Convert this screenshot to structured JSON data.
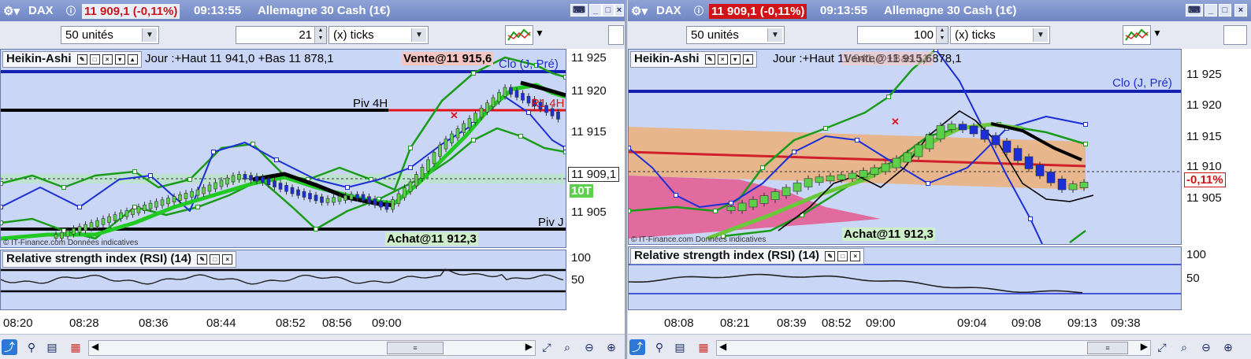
{
  "left": {
    "title": {
      "symbol": "DAX",
      "price": "11 909,1 (-0,11%)",
      "time": "09:13:55",
      "instrument": "Allemagne 30 Cash (1€)"
    },
    "toolbar": {
      "units": "50 unités",
      "ticks_value": "21",
      "ticks_label": "(x) ticks"
    },
    "chart": {
      "indicator_title": "Heikin-Ashi",
      "info": "Jour :+Haut 11 941,0 +Bas 11 878,1",
      "vente": "Vente@11 915,6",
      "achat": "Achat@11 912,3",
      "clo_label": "Clo (J, Pré)",
      "piv4h": "Piv 4H",
      "r1_4h": "R1 4H",
      "pivj": "Piv J",
      "copyright": "© IT-Finance.com  Données indicatives",
      "price_axis": [
        "11 925",
        "11 920",
        "11 915",
        "11 909,1",
        "11 905"
      ],
      "badge_10t": "10T"
    },
    "rsi": {
      "title": "Relative strength index (RSI) (14)",
      "axis": [
        "100",
        "50"
      ]
    },
    "time_axis": [
      "08:20",
      "08:28",
      "08:36",
      "08:44",
      "08:52",
      "08:56",
      "09:00"
    ]
  },
  "right": {
    "title": {
      "symbol": "DAX",
      "price": "11 909,1 (-0,11%)",
      "time": "09:13:55",
      "instrument": "Allemagne 30 Cash (1€)"
    },
    "toolbar": {
      "units": "50 unités",
      "ticks_value": "100",
      "ticks_label": "(x) ticks"
    },
    "chart": {
      "indicator_title": "Heikin-Ashi",
      "info": "Jour :+Haut 11 941,0 +Bas 11 878,1",
      "vente_overlap": "Vente@11 915,6",
      "achat": "Achat@11 912,3",
      "clo_label": "Clo (J, Pré)",
      "copyright": "© IT-Finance.com  Données indicatives",
      "price_axis": [
        "11 925",
        "11 920",
        "11 915",
        "11 910",
        "-0,11%",
        "11 905"
      ]
    },
    "rsi": {
      "title": "Relative strength index (RSI) (14)",
      "axis": [
        "100",
        "50"
      ]
    },
    "time_axis": [
      "08:08",
      "08:21",
      "08:39",
      "08:52",
      "09:00",
      "09:04",
      "09:08",
      "09:13",
      "09:38"
    ]
  },
  "colors": {
    "chart_bg": "#cad6f5",
    "bull": "#5ccf4b",
    "bear": "#1c2fd6",
    "price_up": "#2ecc40",
    "price_down": "#e2141a",
    "ema": "#22c922",
    "band": "#f0ab6a",
    "pink": "#e5578e"
  }
}
